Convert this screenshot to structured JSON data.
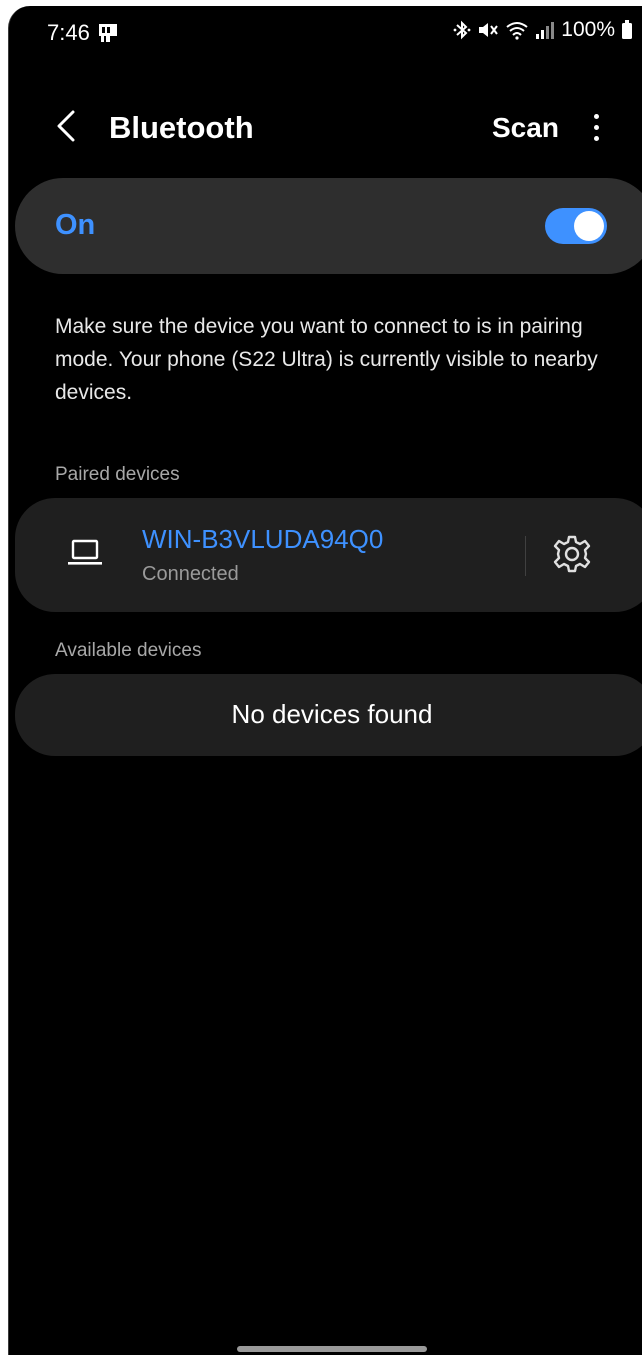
{
  "status_bar": {
    "time": "7:46",
    "battery": "100%"
  },
  "header": {
    "title": "Bluetooth",
    "scan_label": "Scan"
  },
  "bluetooth_toggle": {
    "label": "On",
    "state": "on"
  },
  "description": "Make sure the device you want to connect to is in pairing mode. Your phone (S22 Ultra) is currently visible to nearby devices.",
  "paired": {
    "section_label": "Paired devices",
    "devices": [
      {
        "name": "WIN-B3VLUDA94Q0",
        "status": "Connected",
        "icon": "laptop-icon"
      }
    ]
  },
  "available": {
    "section_label": "Available devices",
    "empty_message": "No devices found"
  },
  "colors": {
    "accent": "#3e91ff",
    "background": "#000000",
    "card": "#1f1f1f",
    "toggle_card": "#2e2e2e"
  }
}
